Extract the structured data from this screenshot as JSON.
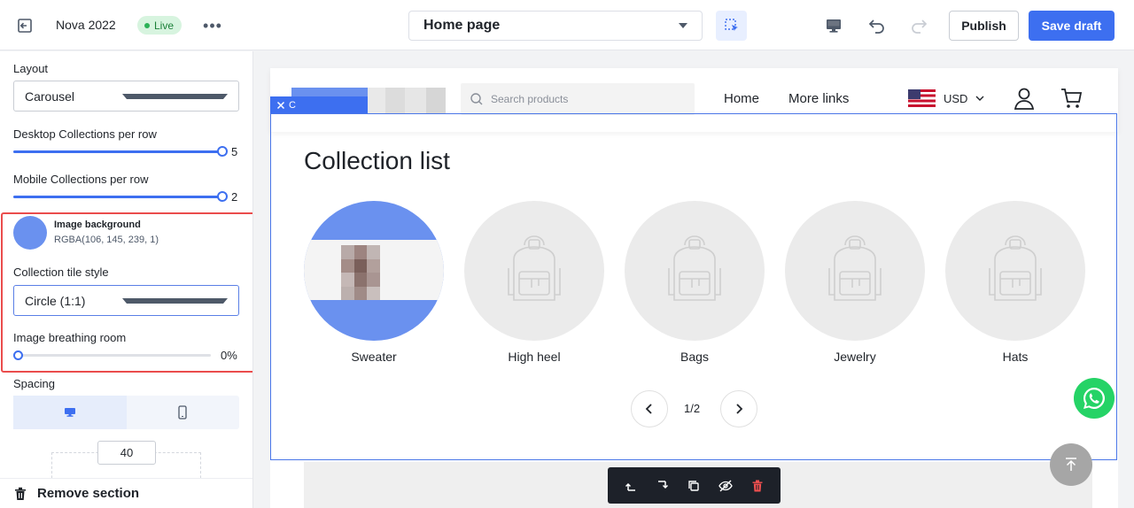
{
  "topbar": {
    "site_name": "Nova 2022",
    "status_badge": "Live",
    "more_label": "•••",
    "page_selector": "Home page",
    "publish_label": "Publish",
    "save_label": "Save draft",
    "accent_color": "#3d6ff0"
  },
  "panel": {
    "layout": {
      "label": "Layout",
      "value": "Carousel"
    },
    "desktop_per_row": {
      "label": "Desktop Collections per row",
      "value": "5",
      "fraction": 1.0
    },
    "mobile_per_row": {
      "label": "Mobile Collections per row",
      "value": "2",
      "fraction": 1.0
    },
    "image_background": {
      "title": "Image background",
      "value": "RGBA(106, 145, 239, 1)",
      "color": "#6a91ef"
    },
    "tile_style": {
      "label": "Collection tile style",
      "value": "Circle (1:1)"
    },
    "breathing_room": {
      "label": "Image breathing room",
      "value": "0%",
      "fraction": 0.0
    },
    "spacing": {
      "label": "Spacing",
      "value": "40"
    },
    "remove_label": "Remove section"
  },
  "store": {
    "search_placeholder": "Search products",
    "nav": [
      "Home",
      "More links"
    ],
    "currency": "USD",
    "section_tag": "C",
    "collection_title": "Collection list",
    "collections": [
      {
        "name": "Sweater",
        "has_image": true
      },
      {
        "name": "High heel",
        "has_image": false
      },
      {
        "name": "Bags",
        "has_image": false
      },
      {
        "name": "Jewelry",
        "has_image": false
      },
      {
        "name": "Hats",
        "has_image": false
      }
    ],
    "page_indicator": "1/2"
  }
}
